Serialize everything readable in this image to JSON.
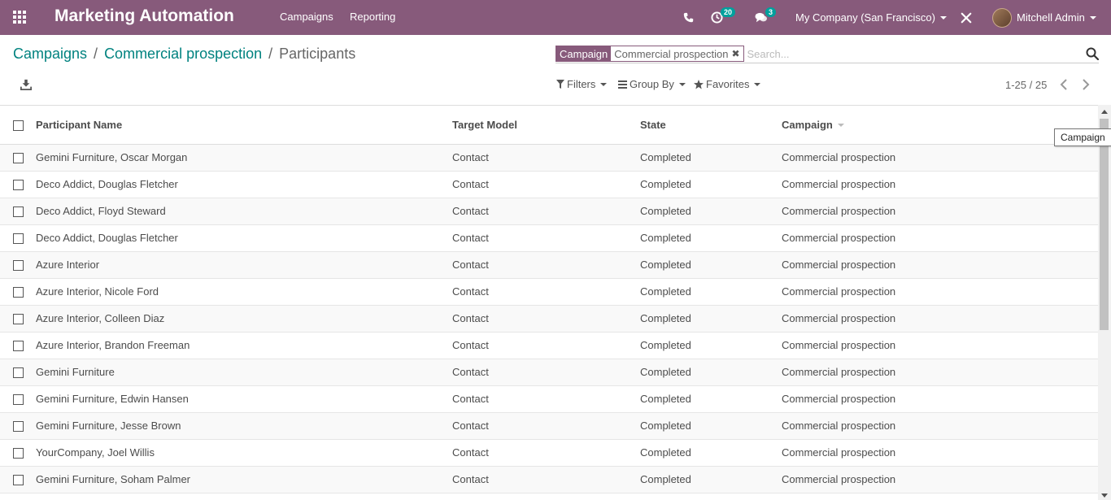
{
  "navbar": {
    "app_title": "Marketing Automation",
    "menu": [
      "Campaigns",
      "Reporting"
    ],
    "activity_count": "20",
    "messages_count": "3",
    "company": "My Company (San Francisco)",
    "user": "Mitchell Admin",
    "color": "#875a7b"
  },
  "breadcrumb": {
    "items": [
      "Campaigns",
      "Commercial prospection"
    ],
    "current": "Participants"
  },
  "search": {
    "facet_label": "Campaign",
    "facet_value": "Commercial prospection",
    "placeholder": "Search..."
  },
  "filters": {
    "filters_label": "Filters",
    "groupby_label": "Group By",
    "favorites_label": "Favorites"
  },
  "pager": {
    "value": "1-25 / 25"
  },
  "table": {
    "columns": [
      "Participant Name",
      "Target Model",
      "State",
      "Campaign"
    ],
    "rows": [
      [
        "Gemini Furniture, Oscar Morgan",
        "Contact",
        "Completed",
        "Commercial prospection"
      ],
      [
        "Deco Addict, Douglas Fletcher",
        "Contact",
        "Completed",
        "Commercial prospection"
      ],
      [
        "Deco Addict, Floyd Steward",
        "Contact",
        "Completed",
        "Commercial prospection"
      ],
      [
        "Deco Addict, Douglas Fletcher",
        "Contact",
        "Completed",
        "Commercial prospection"
      ],
      [
        "Azure Interior",
        "Contact",
        "Completed",
        "Commercial prospection"
      ],
      [
        "Azure Interior, Nicole Ford",
        "Contact",
        "Completed",
        "Commercial prospection"
      ],
      [
        "Azure Interior, Colleen Diaz",
        "Contact",
        "Completed",
        "Commercial prospection"
      ],
      [
        "Azure Interior, Brandon Freeman",
        "Contact",
        "Completed",
        "Commercial prospection"
      ],
      [
        "Gemini Furniture",
        "Contact",
        "Completed",
        "Commercial prospection"
      ],
      [
        "Gemini Furniture, Edwin Hansen",
        "Contact",
        "Completed",
        "Commercial prospection"
      ],
      [
        "Gemini Furniture, Jesse Brown",
        "Contact",
        "Completed",
        "Commercial prospection"
      ],
      [
        "YourCompany, Joel Willis",
        "Contact",
        "Completed",
        "Commercial prospection"
      ],
      [
        "Gemini Furniture, Soham Palmer",
        "Contact",
        "Completed",
        "Commercial prospection"
      ]
    ]
  },
  "tooltip": {
    "text": "Campaign"
  }
}
